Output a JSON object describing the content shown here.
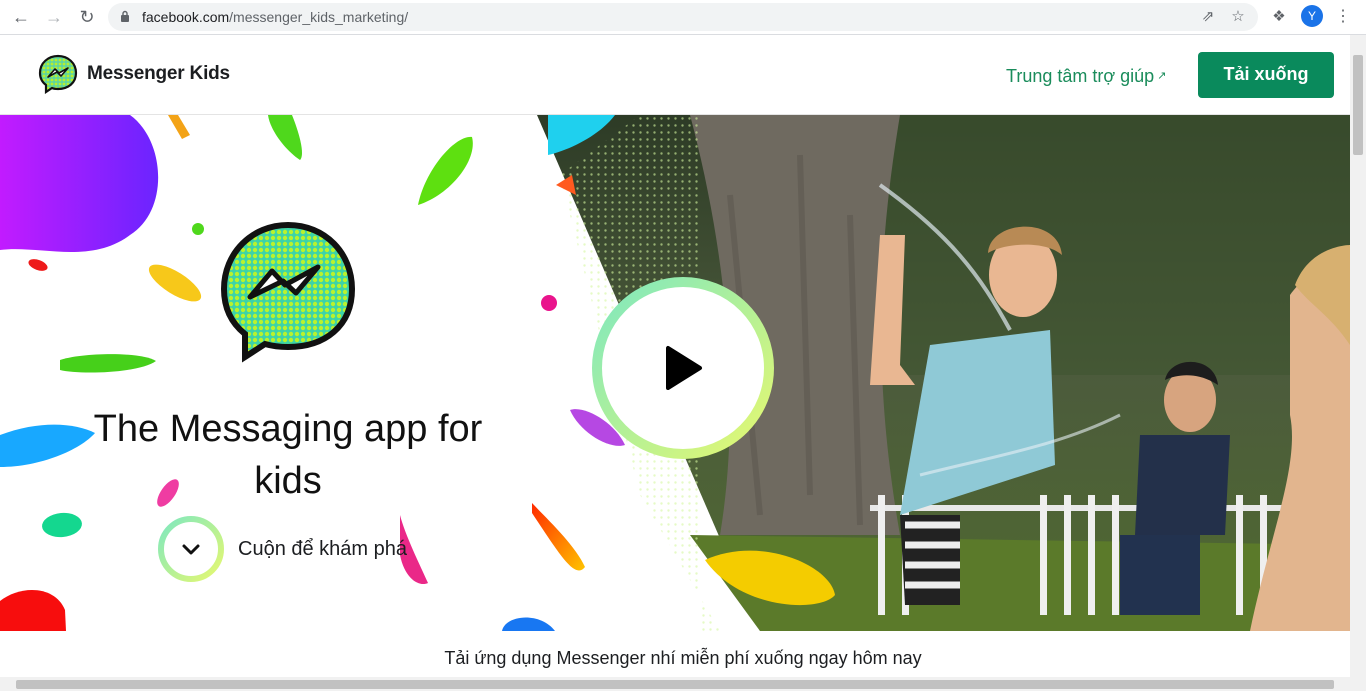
{
  "browser": {
    "url_domain": "facebook.com",
    "url_path": "/messenger_kids_marketing/",
    "profile_initial": "Y"
  },
  "header": {
    "brand": "Messenger Kids",
    "help_link": "Trung tâm trợ giúp",
    "download_button": "Tải xuống"
  },
  "hero": {
    "title": "The Messaging app for kids",
    "scroll_label": "Cuộn để khám phá"
  },
  "footer_strip": {
    "text": "Tải ứng dụng Messenger nhí miễn phí xuống ngay hôm nay"
  },
  "colors": {
    "accent_green": "#0a8a5c",
    "link_green": "#1a8c5b"
  },
  "icons": [
    "back-arrow-icon",
    "forward-arrow-icon",
    "reload-icon",
    "lock-icon",
    "share-icon",
    "star-icon",
    "extensions-icon",
    "menu-dots-icon",
    "external-link-icon",
    "chevron-down-icon",
    "play-icon"
  ]
}
